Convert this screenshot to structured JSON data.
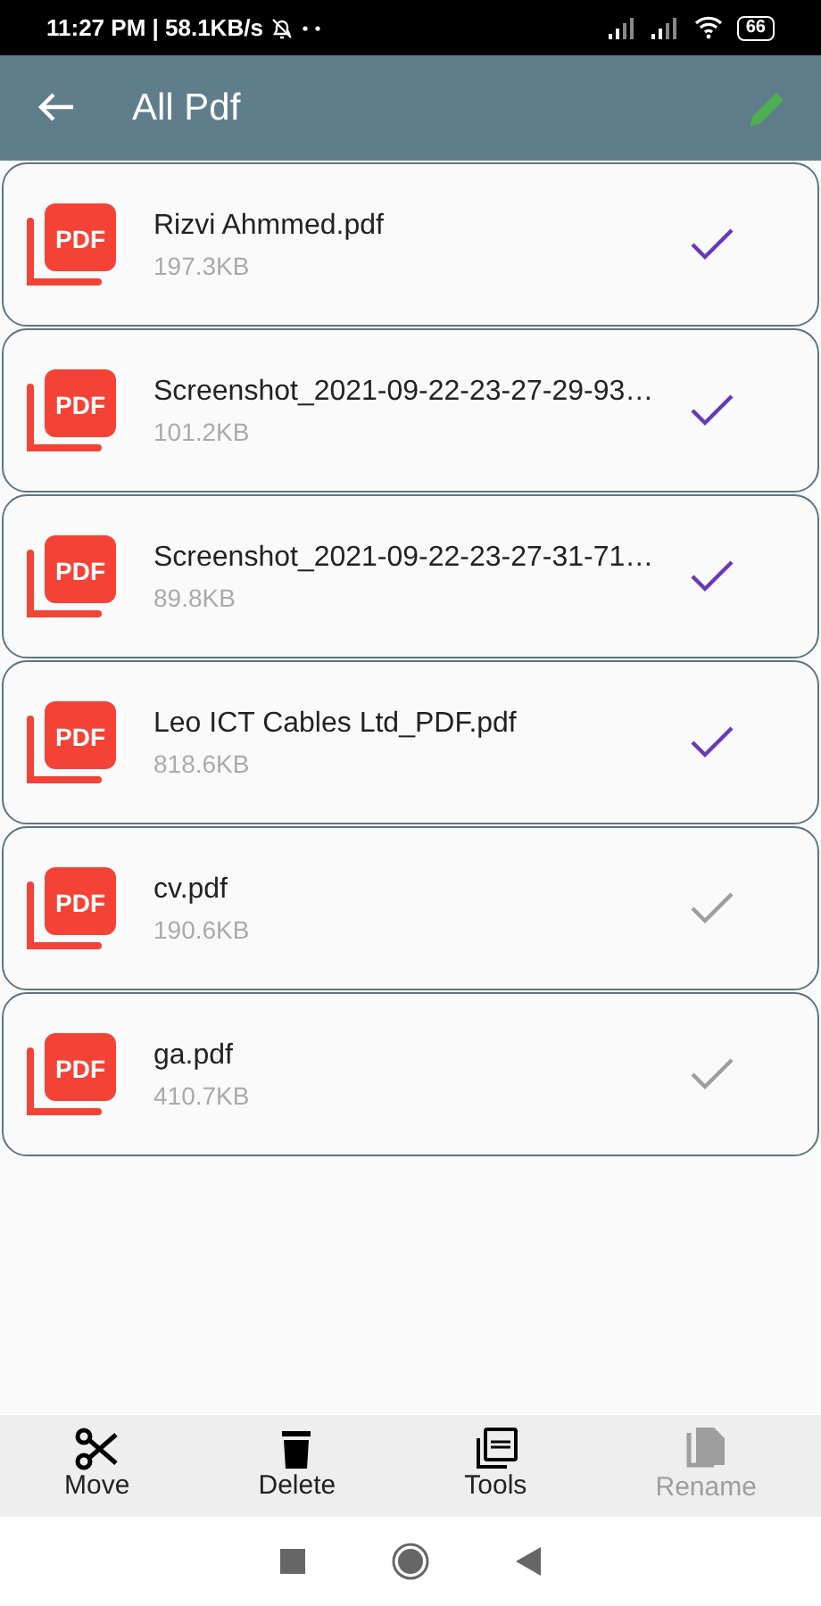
{
  "status_bar": {
    "time": "11:27 PM | 58.1KB/s",
    "battery": "66"
  },
  "app_bar": {
    "title": "All Pdf"
  },
  "files": [
    {
      "badge": "PDF",
      "name": "Rizvi Ahmmed.pdf",
      "size": "197.3KB",
      "selected": true
    },
    {
      "badge": "PDF",
      "name": "Screenshot_2021-09-22-23-27-29-93…",
      "size": "101.2KB",
      "selected": true
    },
    {
      "badge": "PDF",
      "name": "Screenshot_2021-09-22-23-27-31-71…",
      "size": "89.8KB",
      "selected": true
    },
    {
      "badge": "PDF",
      "name": "Leo ICT Cables Ltd_PDF.pdf",
      "size": "818.6KB",
      "selected": true
    },
    {
      "badge": "PDF",
      "name": "cv.pdf",
      "size": "190.6KB",
      "selected": false
    },
    {
      "badge": "PDF",
      "name": "ga.pdf",
      "size": "410.7KB",
      "selected": false
    }
  ],
  "toolbar": [
    {
      "kind": "move",
      "label": "Move",
      "disabled": false
    },
    {
      "kind": "delete",
      "label": "Delete",
      "disabled": false
    },
    {
      "kind": "tools",
      "label": "Tools",
      "disabled": false
    },
    {
      "kind": "rename",
      "label": "Rename",
      "disabled": true
    }
  ]
}
